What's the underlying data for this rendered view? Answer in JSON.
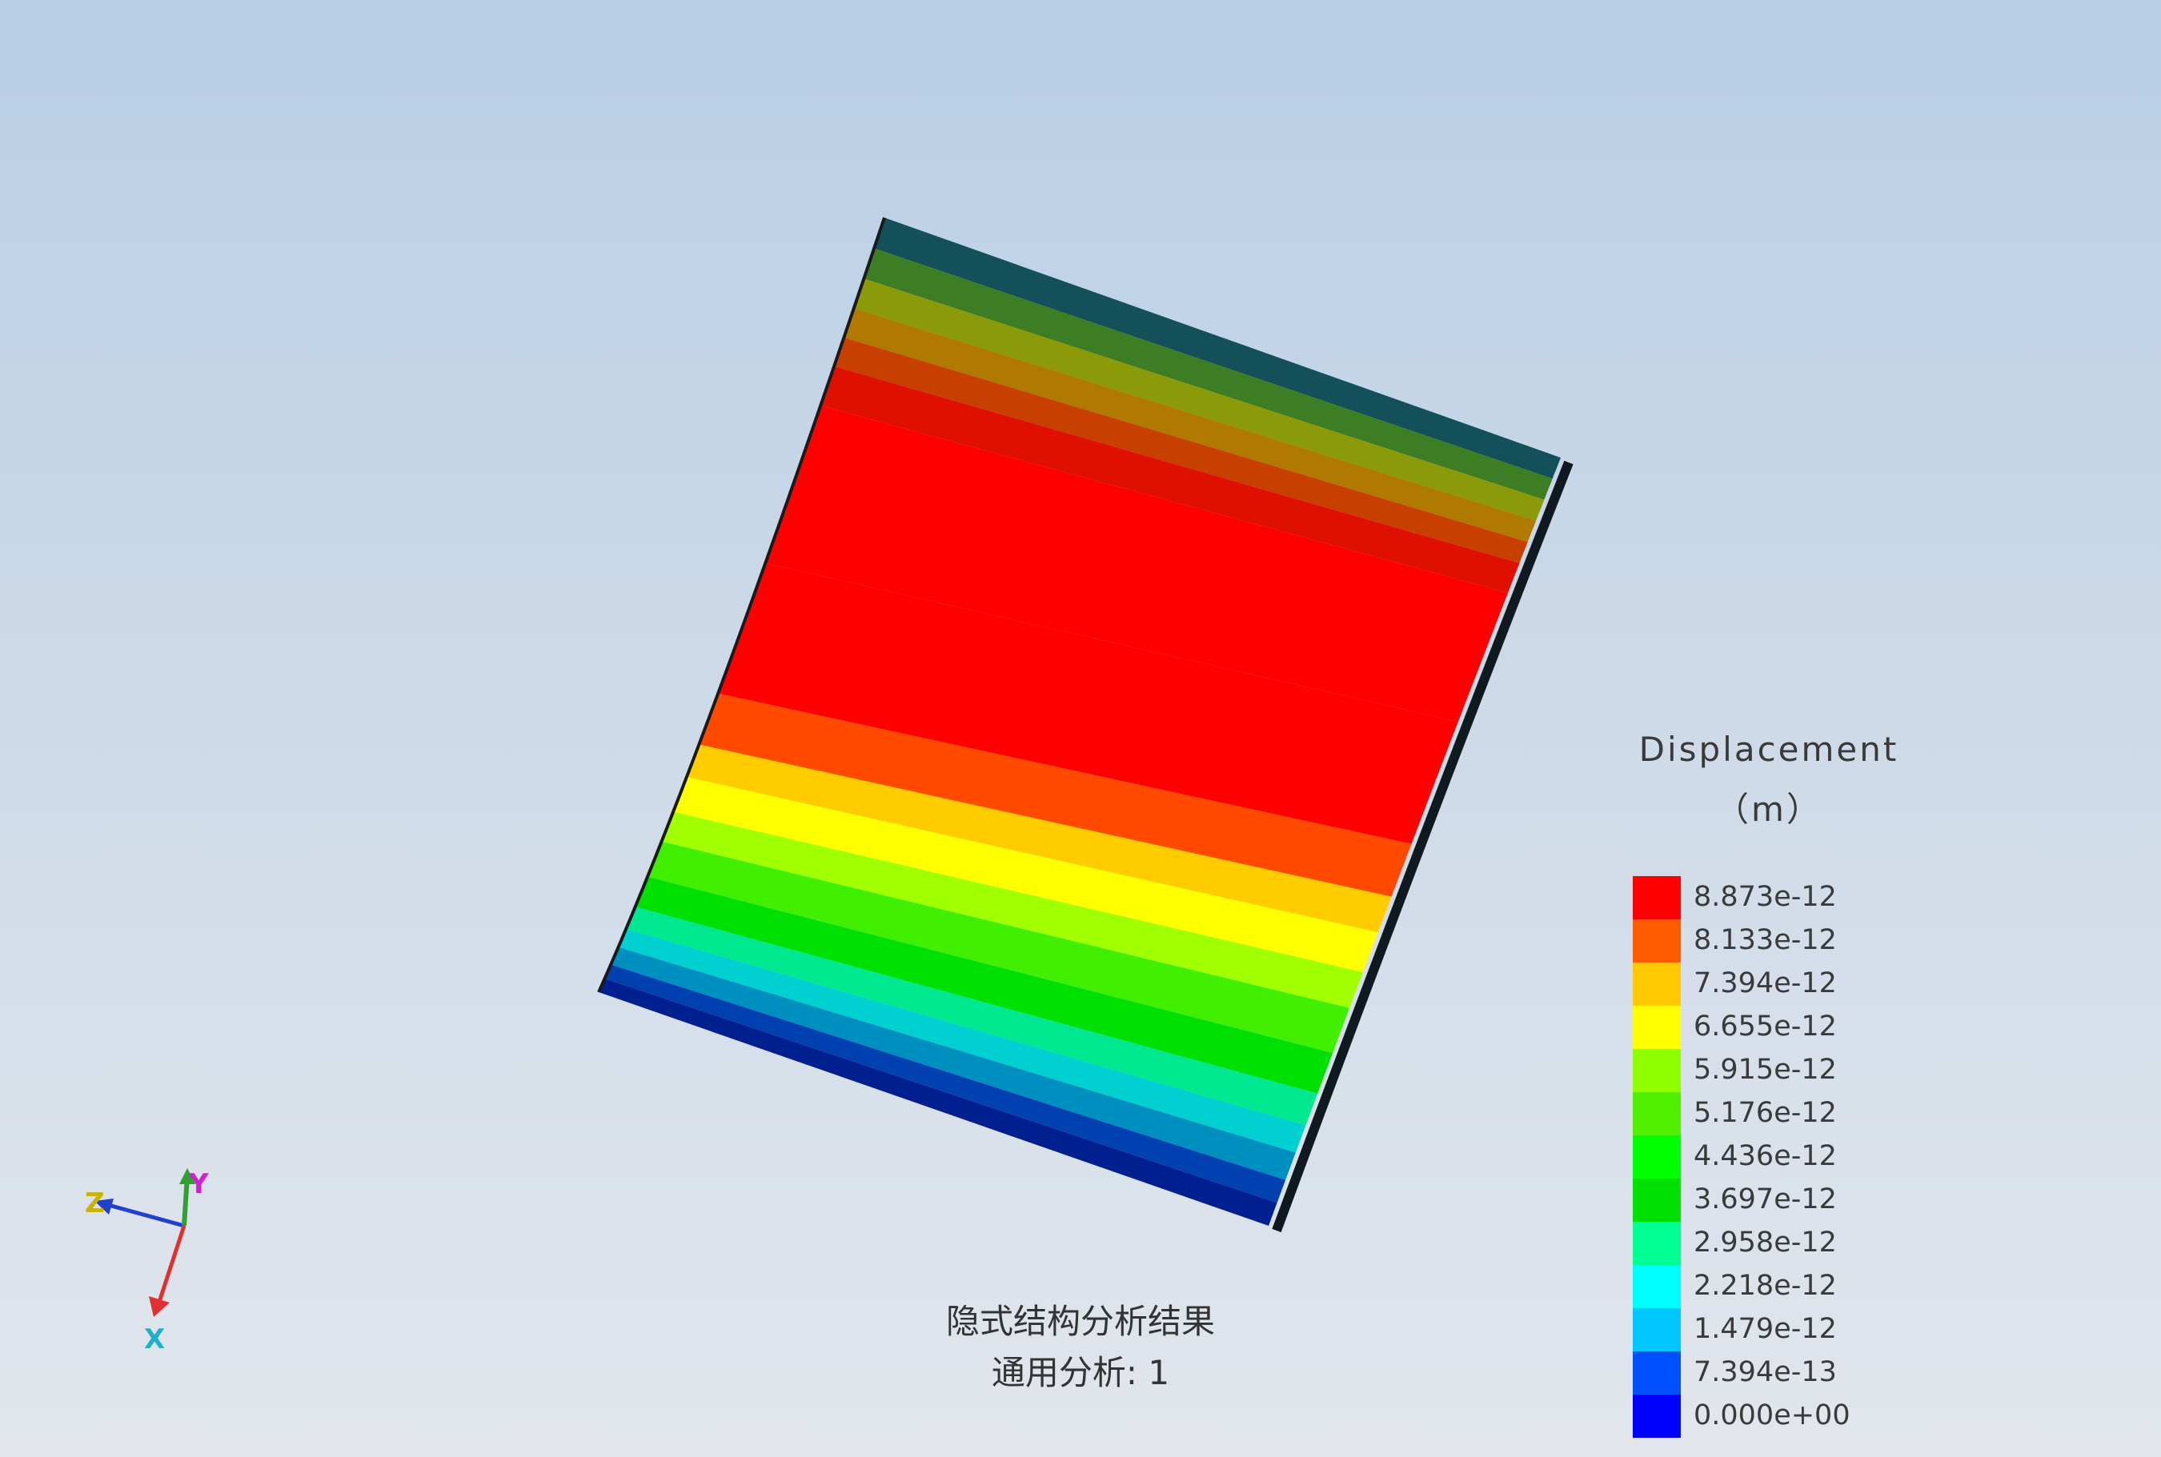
{
  "legend": {
    "title": "Displacement",
    "unit": "（m）",
    "entries": [
      {
        "label": "8.873e-12",
        "color": "#ff0000"
      },
      {
        "label": "8.133e-12",
        "color": "#ff5a00"
      },
      {
        "label": "7.394e-12",
        "color": "#ffc800"
      },
      {
        "label": "6.655e-12",
        "color": "#ffff00"
      },
      {
        "label": "5.915e-12",
        "color": "#90ff00"
      },
      {
        "label": "5.176e-12",
        "color": "#50ef00"
      },
      {
        "label": "4.436e-12",
        "color": "#00ff00"
      },
      {
        "label": "3.697e-12",
        "color": "#00e000"
      },
      {
        "label": "2.958e-12",
        "color": "#00ff90"
      },
      {
        "label": "2.218e-12",
        "color": "#00ffff"
      },
      {
        "label": "1.479e-12",
        "color": "#00c8ff"
      },
      {
        "label": "7.394e-13",
        "color": "#0050ff"
      },
      {
        "label": "0.000e+00",
        "color": "#0000ff"
      }
    ]
  },
  "caption": {
    "line1": "隐式结构分析结果",
    "line2": "通用分析: 1"
  },
  "triad": {
    "z_label": "Z",
    "y_label": "Y",
    "x_label": "X",
    "x_color": "#e03030",
    "y_color": "#30a030",
    "z_color": "#2040d0"
  },
  "model": {
    "band_colors": [
      "#14505a",
      "#3d7d24",
      "#8b9a08",
      "#b07a00",
      "#c84000",
      "#e01000",
      "#ff0000",
      "#ff0000",
      "#ff4a00",
      "#ffcc00",
      "#ffff00",
      "#a0ff00",
      "#40f000",
      "#00e000",
      "#00e890",
      "#00d0d0",
      "#0090c0",
      "#0040b0",
      "#002090"
    ]
  }
}
